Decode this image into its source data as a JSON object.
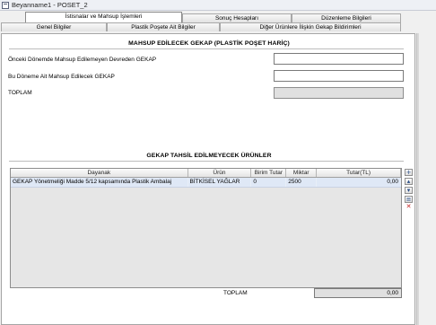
{
  "window": {
    "title": "Beyanname1 - POSET_2"
  },
  "tabs_top": [
    {
      "label": "İstisnalar ve Mahsup İşlemleri",
      "active": true
    },
    {
      "label": "Sonuç Hesapları",
      "active": false
    },
    {
      "label": "Düzenleme Bilgileri",
      "active": false
    }
  ],
  "tabs_bottom": [
    {
      "label": "Genel Bilgiler"
    },
    {
      "label": "Plastik Poşete Ait Bilgiler"
    },
    {
      "label": "Diğer Ürünlere İlişkin Gekap Bildirimleri"
    }
  ],
  "mahsup": {
    "title": "MAHSUP EDİLECEK GEKAP (PLASTİK POŞET HARİÇ)",
    "onceki_label": "Önceki Dönemde Mahsup Edilemeyen Devreden GEKAP",
    "onceki_value": "",
    "bu_donem_label": "Bu Döneme Ait Mahsup Edilecek GEKAP",
    "bu_donem_value": "",
    "toplam_label": "TOPLAM",
    "toplam_value": ""
  },
  "urunler": {
    "title": "GEKAP TAHSİL EDİLMEYECEK ÜRÜNLER",
    "columns": [
      "Dayanak",
      "Ürün",
      "Birim Tutar",
      "Miktar",
      "Tutar(TL)"
    ],
    "rows": [
      [
        "GEKAP Yönetmeliği Madde 5/12 kapsamında Plastik Ambalaj",
        "BİTKİSEL YAĞLAR",
        "0",
        "2500",
        "0,00"
      ]
    ],
    "toplam_label": "TOPLAM",
    "toplam_value": "0,00"
  },
  "icons": {
    "add": "add-row-icon",
    "up": "move-up-icon",
    "down": "move-down-icon",
    "edit": "edit-row-icon",
    "delete": "delete-row-icon"
  }
}
